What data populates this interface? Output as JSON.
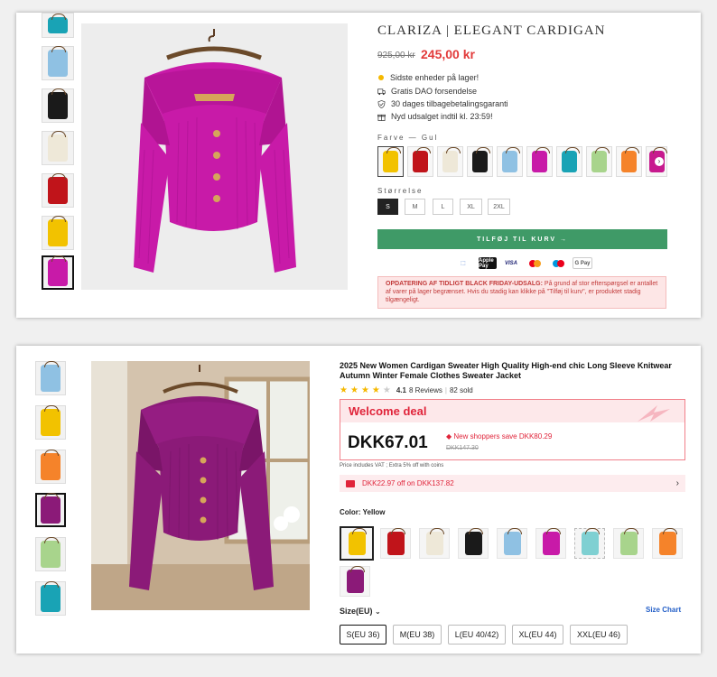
{
  "colors": {
    "magenta": "#c81aa8",
    "plum": "#8b1a78",
    "yellow": "#f2c200",
    "red": "#c0141a",
    "cream": "#eee8d8",
    "black": "#1a1a1a",
    "lightblue": "#8fc1e3",
    "teal": "#19a3b5",
    "green": "#a8d48c",
    "orange": "#f5832a",
    "pink": "#c71a8e",
    "brand_green": "#3f9a67",
    "price_red": "#e23a3a"
  },
  "shop1": {
    "title": "CLARIZA | ELEGANT CARDIGAN",
    "old_price": "925,00 kr",
    "new_price": "245,00 kr",
    "perks": [
      {
        "icon": "dot-icon",
        "text": "Sidste enheder på lager!"
      },
      {
        "icon": "truck-icon",
        "text": "Gratis DAO forsendelse"
      },
      {
        "icon": "shield-check-icon",
        "text": "30 dages tilbagebetalingsgaranti"
      },
      {
        "icon": "gift-icon",
        "text": "Nyd udsalget indtil kl. 23:59!"
      }
    ],
    "color_label": "Farve — Gul",
    "size_label": "Størrelse",
    "sizes": [
      "S",
      "M",
      "L",
      "XL",
      "2XL"
    ],
    "selected_size": "S",
    "add_to_cart": "TILFØJ TIL KURV →",
    "payments": [
      "Apple Pay",
      "VISA",
      "Mastercard",
      "Maestro",
      "G Pay"
    ],
    "notice_bold": "OPDATERING AF TIDLIGT BLACK FRIDAY-UDSALG:",
    "notice_text": " På grund af stor efterspørgsel er antallet af varer på lager begrænset. Hvis du stadig kan klikke på \"Tilføj til kurv\", er produktet stadig tilgængeligt."
  },
  "shop2": {
    "title": "2025 New Women Cardigan Sweater High Quality High-end chic Long Sleeve Knitwear Autumn Winter Female Clothes Sweater Jacket",
    "rating": "4.1",
    "reviews": "8 Reviews",
    "sold": "82 sold",
    "deal_title": "Welcome deal",
    "price": "DKK67.01",
    "save_text": "New shoppers save DKK80.29",
    "strike_price": "DKK147.30",
    "vat_text": "Price includes VAT ; Extra 5% off with coins",
    "coupon_text": "DKK22.97 off on DKK137.82",
    "color_label": "Color: Yellow",
    "size_label": "Size(EU)",
    "size_chart": "Size Chart",
    "sizes": [
      "S(EU 36)",
      "M(EU 38)",
      "L(EU 40/42)",
      "XL(EU 44)",
      "XXL(EU 46)"
    ]
  }
}
